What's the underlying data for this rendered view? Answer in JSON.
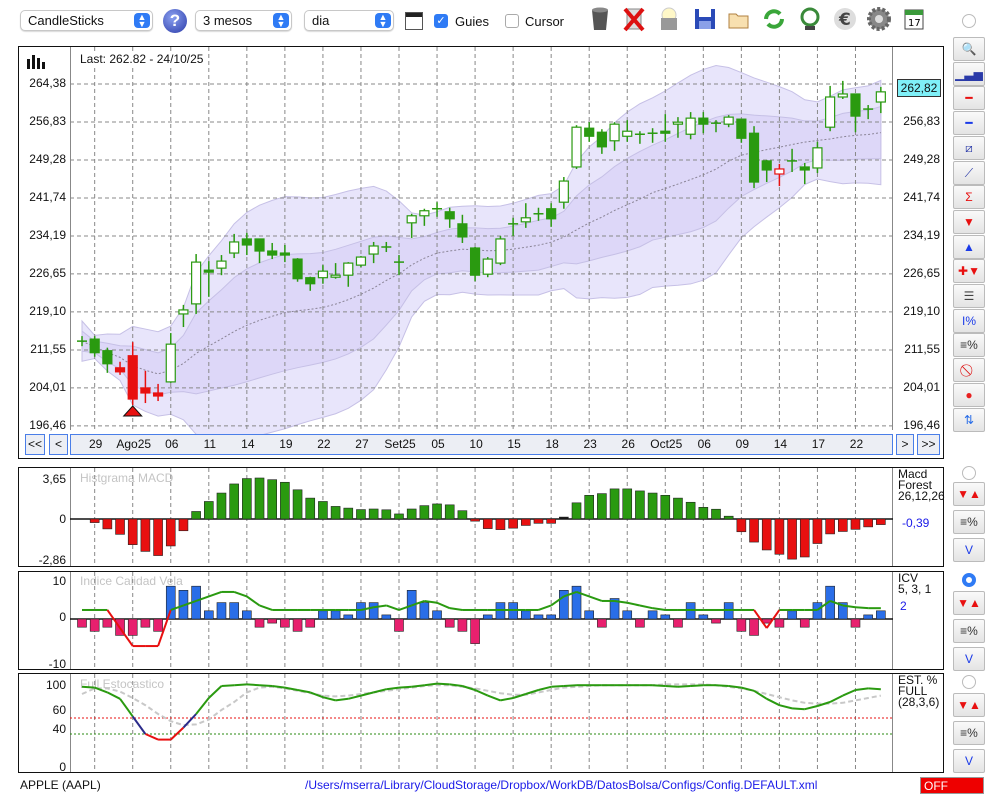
{
  "toolbar": {
    "chart_type": "CandleSticks",
    "period": "3 mesos",
    "interval": "dia",
    "guides_label": "Guies",
    "guides_checked": true,
    "cursor_label": "Cursor",
    "cursor_checked": false
  },
  "main": {
    "last_label": "Last: 262.82 - 24/10/25",
    "last_price_badge": "262,82",
    "y_labels": [
      "264,38",
      "256,83",
      "249,28",
      "241,74",
      "234,19",
      "226,65",
      "219,10",
      "211,55",
      "204,01",
      "196,46"
    ],
    "dates": [
      "29",
      "Ago25",
      "06",
      "11",
      "14",
      "19",
      "22",
      "27",
      "Set25",
      "05",
      "10",
      "15",
      "18",
      "23",
      "26",
      "Oct25",
      "06",
      "09",
      "14",
      "17",
      "22"
    ],
    "nav": {
      "first": "<<",
      "prev": "<",
      "next": ">",
      "last": ">>"
    }
  },
  "macd": {
    "title": "Histgrama MACD",
    "label_line1": "Macd",
    "label_line2": "Forest",
    "params": "26,12,26",
    "value": "-0,39",
    "y_labels": [
      "3,65",
      "0",
      "-2,86"
    ]
  },
  "icv": {
    "title": "Indice Calidad Vela",
    "label": "ICV",
    "params": "5, 3, 1",
    "value": "2",
    "y_labels": [
      "10",
      "0",
      "-10"
    ]
  },
  "stoch": {
    "title": "Full Estocastico",
    "label_line1": "EST. %",
    "label_line2": "FULL",
    "params": "(28,3,6)",
    "y_labels": [
      "100",
      "60",
      "40",
      "0"
    ]
  },
  "status": {
    "symbol": "APPLE (AAPL)",
    "config_path": "/Users/mserra/Library/CloudStorage/Dropbox/WorkDB/DatosBolsa/Configs/Config.DEFAULT.xml",
    "mode": "OFF"
  },
  "colors": {
    "up": "#2a9a10",
    "down": "#e81010",
    "icv_pos": "#2a6ee8",
    "icv_neg": "#e8206e",
    "band_outer": "#e8e5fb",
    "band_inner": "#ddd7f8",
    "badge": "#7ff0f8",
    "link": "#1a1ae8"
  },
  "chart_data": {
    "type": "candlestick",
    "price_range": [
      196.46,
      264.38
    ],
    "date_label_every": 3,
    "date_label_start_index": 1,
    "red_signal_candles": [
      3,
      4,
      5,
      6,
      55
    ],
    "buy_marker_index": 4,
    "candles_ohlc": [
      [
        213.3,
        214.3,
        212.3,
        213.3
      ],
      [
        213.7,
        214.3,
        210.2,
        211.0
      ],
      [
        211.4,
        212.0,
        207.0,
        208.8
      ],
      [
        208.0,
        209.2,
        206.6,
        207.2
      ],
      [
        210.4,
        213.1,
        200.6,
        201.8
      ],
      [
        204.0,
        207.4,
        201.0,
        203.0
      ],
      [
        203.0,
        204.8,
        201.4,
        202.4
      ],
      [
        205.2,
        214.9,
        205.0,
        212.7
      ],
      [
        218.7,
        220.5,
        216.1,
        219.5
      ],
      [
        220.7,
        230.6,
        218.7,
        229.0
      ],
      [
        227.4,
        229.2,
        222.1,
        227.0
      ],
      [
        227.8,
        230.4,
        226.4,
        229.2
      ],
      [
        230.8,
        234.6,
        229.8,
        233.0
      ],
      [
        233.6,
        234.8,
        230.4,
        232.4
      ],
      [
        233.6,
        233.6,
        228.8,
        231.2
      ],
      [
        231.2,
        232.8,
        229.6,
        230.4
      ],
      [
        230.8,
        232.4,
        229.0,
        230.4
      ],
      [
        229.6,
        229.8,
        225.1,
        225.7
      ],
      [
        225.9,
        226.1,
        223.3,
        224.7
      ],
      [
        225.9,
        228.4,
        224.7,
        227.2
      ],
      [
        226.3,
        228.8,
        225.7,
        226.4
      ],
      [
        226.4,
        229.0,
        224.1,
        228.8
      ],
      [
        228.4,
        230.2,
        228.0,
        230.0
      ],
      [
        230.6,
        233.0,
        228.8,
        232.2
      ],
      [
        232.0,
        233.0,
        231.0,
        232.0
      ],
      [
        229.0,
        230.4,
        226.4,
        229.0
      ],
      [
        236.8,
        238.6,
        233.8,
        238.2
      ],
      [
        238.2,
        239.6,
        236.2,
        239.2
      ],
      [
        239.6,
        240.9,
        238.0,
        239.6
      ],
      [
        239.0,
        239.8,
        235.8,
        237.6
      ],
      [
        236.6,
        238.4,
        232.8,
        234.0
      ],
      [
        231.8,
        232.0,
        225.2,
        226.4
      ],
      [
        226.6,
        230.0,
        226.0,
        229.6
      ],
      [
        228.8,
        234.2,
        228.4,
        233.6
      ],
      [
        236.6,
        237.8,
        234.2,
        236.6
      ],
      [
        237.0,
        240.7,
        235.8,
        237.8
      ],
      [
        238.6,
        239.8,
        237.2,
        238.6
      ],
      [
        239.6,
        240.7,
        236.0,
        237.6
      ],
      [
        240.9,
        245.9,
        239.6,
        245.1
      ],
      [
        247.9,
        256.2,
        247.5,
        255.8
      ],
      [
        255.6,
        256.8,
        252.9,
        254.0
      ],
      [
        254.8,
        255.4,
        250.5,
        251.9
      ],
      [
        253.1,
        256.8,
        251.1,
        256.4
      ],
      [
        254.0,
        257.2,
        252.9,
        255.0
      ],
      [
        254.4,
        255.0,
        252.5,
        254.4
      ],
      [
        254.6,
        255.6,
        252.7,
        254.6
      ],
      [
        255.0,
        258.4,
        252.9,
        254.6
      ],
      [
        256.4,
        257.8,
        253.7,
        256.8
      ],
      [
        254.4,
        258.8,
        253.4,
        257.6
      ],
      [
        257.6,
        258.8,
        254.6,
        256.4
      ],
      [
        256.6,
        257.2,
        254.8,
        256.6
      ],
      [
        256.4,
        258.2,
        255.8,
        257.8
      ],
      [
        257.4,
        257.4,
        252.7,
        253.6
      ],
      [
        254.6,
        256.0,
        243.7,
        244.9
      ],
      [
        249.1,
        249.3,
        244.9,
        247.3
      ],
      [
        246.5,
        248.5,
        244.1,
        247.5
      ],
      [
        249.1,
        251.5,
        246.9,
        249.1
      ],
      [
        247.9,
        248.7,
        244.5,
        247.3
      ],
      [
        247.7,
        252.9,
        246.7,
        251.7
      ],
      [
        255.8,
        264.0,
        255.0,
        261.8
      ],
      [
        261.8,
        265.0,
        261.4,
        262.4
      ],
      [
        262.4,
        262.4,
        254.8,
        258.0
      ],
      [
        259.4,
        260.2,
        257.4,
        259.4
      ],
      [
        260.8,
        263.8,
        258.6,
        262.82
      ]
    ],
    "macd_hist": [
      0,
      -0.25,
      -0.69,
      -1.07,
      -1.79,
      -2.26,
      -2.55,
      -1.88,
      -0.82,
      0.67,
      1.56,
      2.31,
      3.12,
      3.6,
      3.65,
      3.5,
      3.27,
      2.6,
      1.86,
      1.56,
      1.12,
      0.97,
      0.84,
      0.89,
      0.82,
      0.45,
      0.89,
      1.19,
      1.34,
      1.26,
      0.74,
      -0.15,
      -0.67,
      -0.74,
      -0.64,
      -0.45,
      -0.3,
      -0.3,
      0.17,
      1.44,
      2.11,
      2.26,
      2.68,
      2.68,
      2.5,
      2.31,
      2.11,
      1.86,
      1.49,
      1.04,
      0.87,
      0.25,
      -0.89,
      -1.61,
      -2.16,
      -2.46,
      -2.8,
      -2.65,
      -1.71,
      -1.04,
      -0.87,
      -0.72,
      -0.55,
      -0.39
    ],
    "macd_black_bars": [
      38
    ],
    "macd_range": [
      -2.86,
      3.65
    ],
    "icv_bars": [
      -2,
      -3,
      -2,
      -4,
      -4,
      -2,
      -3,
      8,
      7,
      8,
      2,
      4,
      4,
      2,
      -2,
      -1,
      -2,
      -3,
      -2,
      2,
      2,
      1,
      4,
      4,
      1,
      -3,
      7,
      4,
      2,
      -2,
      -3,
      -6,
      1,
      4,
      4,
      2,
      1,
      1,
      7,
      8,
      2,
      -2,
      5,
      2,
      -2,
      2,
      1,
      -2,
      4,
      1,
      -1,
      4,
      -3,
      -4,
      -1,
      -2,
      2,
      -2,
      4,
      8,
      4,
      -2,
      1,
      2
    ],
    "icv_line": [
      1,
      1,
      1,
      -1,
      -3,
      -3,
      -3,
      1,
      1.5,
      2,
      2.5,
      3,
      3,
      2.5,
      1.5,
      1,
      1,
      1,
      1,
      1,
      1,
      1,
      1,
      1.3,
      1.5,
      1,
      1.5,
      2,
      1.8,
      1.2,
      1,
      1,
      1,
      1,
      1,
      1,
      1,
      1.5,
      2.5,
      3,
      2.5,
      2,
      2,
      1.8,
      1.5,
      1.2,
      1,
      1,
      1,
      1,
      1,
      1,
      1,
      1,
      -1,
      1,
      1,
      1,
      1,
      2,
      1.5,
      1.3,
      1.2,
      1.2
    ],
    "icv_range": [
      -10,
      10
    ],
    "stoch_k": [
      99,
      98,
      92,
      84,
      62,
      40,
      33,
      33,
      48,
      65,
      85,
      100,
      101,
      102,
      101,
      100,
      98,
      95,
      92,
      86,
      82,
      84,
      88,
      92,
      96,
      98,
      99,
      101,
      103,
      102,
      100,
      95,
      88,
      82,
      85,
      90,
      95,
      99,
      100,
      101,
      101,
      101,
      101,
      101,
      101,
      101,
      100,
      99,
      100,
      101,
      101,
      100,
      98,
      94,
      84,
      76,
      72,
      71,
      75,
      80,
      88,
      95,
      97,
      96
    ],
    "stoch_d": [
      90,
      97,
      97,
      93,
      85,
      76,
      65,
      56,
      51,
      52,
      58,
      70,
      80,
      92,
      98,
      99,
      97,
      94,
      91,
      88,
      87,
      88,
      90,
      92,
      94,
      96,
      98,
      100,
      101,
      101,
      99,
      97,
      94,
      91,
      89,
      89,
      92,
      95,
      98,
      99,
      100,
      101,
      101,
      101,
      101,
      101,
      102,
      102,
      102,
      102,
      101,
      99,
      97,
      94,
      90,
      86,
      82,
      79,
      78,
      78,
      79,
      82,
      85,
      88
    ],
    "stoch_levels": [
      60,
      40
    ],
    "stoch_range": [
      0,
      100
    ]
  }
}
